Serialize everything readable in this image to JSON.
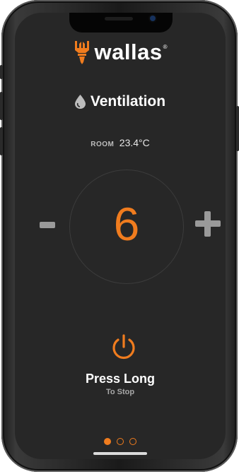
{
  "brand": {
    "name": "wallas",
    "reg": "®"
  },
  "mode": {
    "label": "Ventilation",
    "icon": "drop-icon"
  },
  "room": {
    "label": "ROOM",
    "temperature": "23.4°C"
  },
  "control": {
    "level": "6",
    "minus": "minus-icon",
    "plus": "plus-icon"
  },
  "power": {
    "icon": "power-icon",
    "label": "Press Long",
    "sublabel": "To Stop"
  },
  "pager": {
    "pages": 3,
    "active_index": 0
  },
  "colors": {
    "accent": "#f07c1e",
    "background": "#272727",
    "button_gray": "#9a9a9a"
  }
}
